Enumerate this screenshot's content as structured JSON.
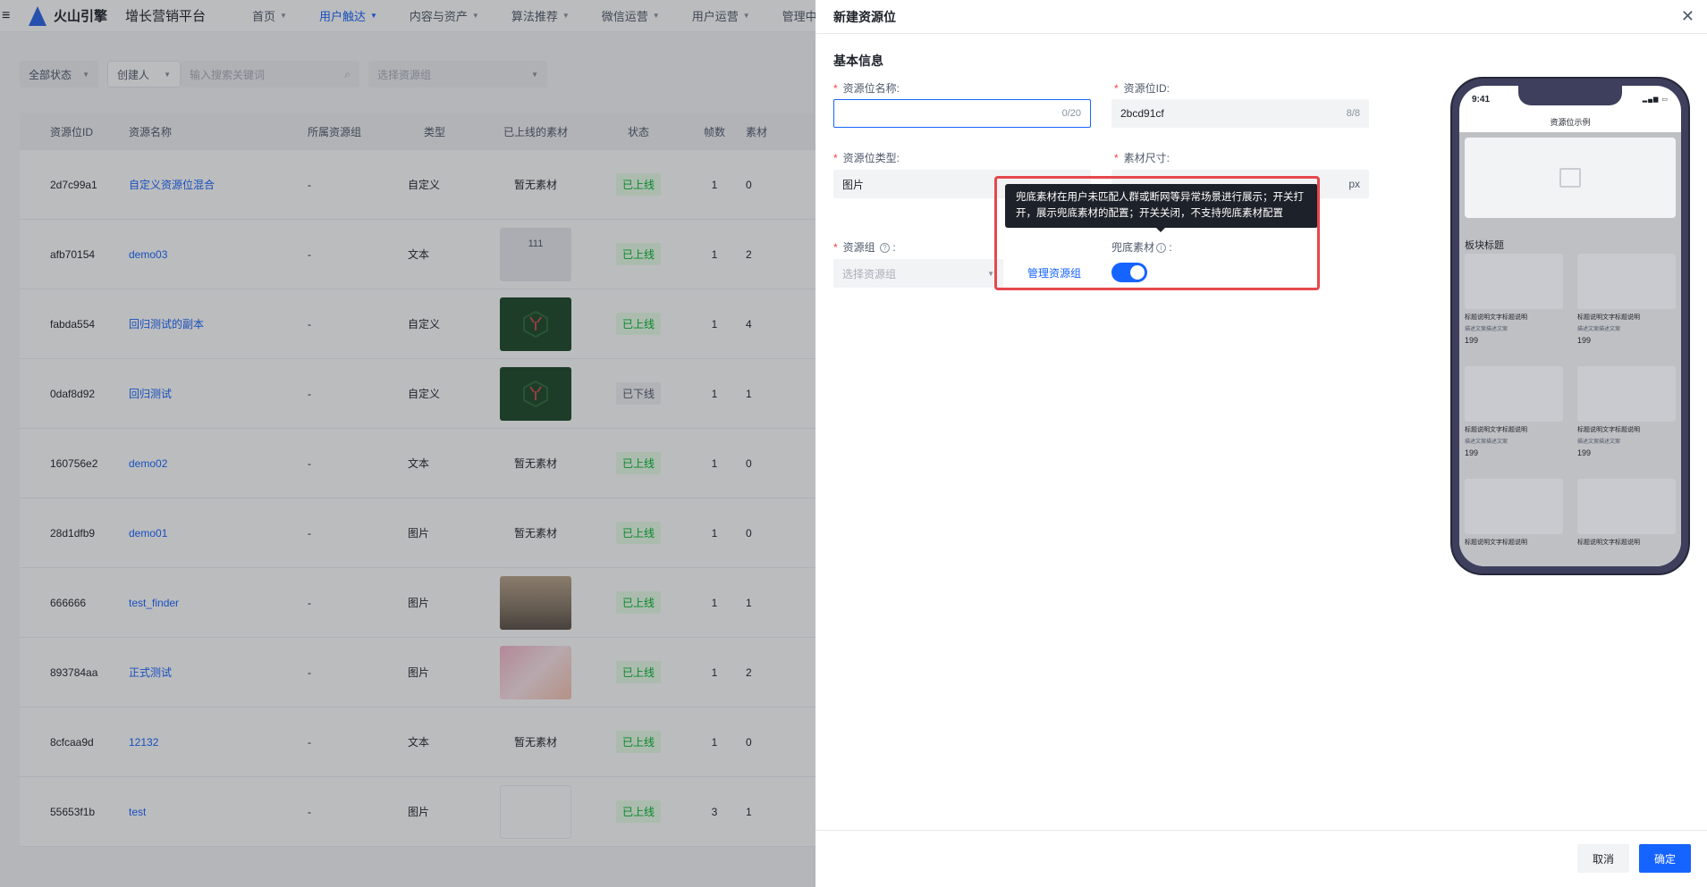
{
  "app": {
    "brand": "火山引擎",
    "platform": "增长营销平台",
    "nav": [
      {
        "label": "首页",
        "active": false
      },
      {
        "label": "用户触达",
        "active": true
      },
      {
        "label": "内容与资产",
        "active": false
      },
      {
        "label": "算法推荐",
        "active": false
      },
      {
        "label": "微信运营",
        "active": false
      },
      {
        "label": "用户运营",
        "active": false
      },
      {
        "label": "管理中心",
        "active": false
      }
    ]
  },
  "filters": {
    "status": "全部状态",
    "creator": "创建人",
    "search_placeholder": "输入搜索关键词",
    "group_placeholder": "选择资源组"
  },
  "table": {
    "columns": [
      "资源位ID",
      "资源名称",
      "所属资源组",
      "类型",
      "已上线的素材",
      "状态",
      "帧数",
      "素材"
    ],
    "rows": [
      {
        "id": "2d7c99a1",
        "name": "自定义资源位混合",
        "group": "-",
        "type": "自定义",
        "material": "暂无素材",
        "status": "已上线",
        "frames": "1",
        "count": "0"
      },
      {
        "id": "afb70154",
        "name": "demo03",
        "group": "-",
        "type": "文本",
        "material": "111",
        "status": "已上线",
        "frames": "1",
        "count": "2"
      },
      {
        "id": "fabda554",
        "name": "回归测试的副本",
        "group": "-",
        "type": "自定义",
        "material": "",
        "status": "已上线",
        "frames": "1",
        "count": "4"
      },
      {
        "id": "0daf8d92",
        "name": "回归测试",
        "group": "-",
        "type": "自定义",
        "material": "",
        "status": "已下线",
        "frames": "1",
        "count": "1"
      },
      {
        "id": "160756e2",
        "name": "demo02",
        "group": "-",
        "type": "文本",
        "material": "暂无素材",
        "status": "已上线",
        "frames": "1",
        "count": "0"
      },
      {
        "id": "28d1dfb9",
        "name": "demo01",
        "group": "-",
        "type": "图片",
        "material": "暂无素材",
        "status": "已上线",
        "frames": "1",
        "count": "0"
      },
      {
        "id": "666666",
        "name": "test_finder",
        "group": "-",
        "type": "图片",
        "material": "",
        "status": "已上线",
        "frames": "1",
        "count": "1"
      },
      {
        "id": "893784aa",
        "name": "正式测试",
        "group": "-",
        "type": "图片",
        "material": "",
        "status": "已上线",
        "frames": "1",
        "count": "2"
      },
      {
        "id": "8cfcaa9d",
        "name": "12132",
        "group": "-",
        "type": "文本",
        "material": "暂无素材",
        "status": "已上线",
        "frames": "1",
        "count": "0"
      },
      {
        "id": "55653f1b",
        "name": "test",
        "group": "-",
        "type": "图片",
        "material": "",
        "status": "已上线",
        "frames": "3",
        "count": "1"
      }
    ]
  },
  "drawer": {
    "title": "新建资源位",
    "section": "基本信息",
    "fields": {
      "name_label": "资源位名称:",
      "name_counter": "0/20",
      "id_label": "资源位ID:",
      "id_value": "2bcd91cf",
      "id_counter": "8/8",
      "type_label": "资源位类型:",
      "type_value": "图片",
      "size_label": "素材尺寸:",
      "size_unit": "px",
      "group_label": "资源组",
      "group_placeholder": "选择资源组",
      "manage_group": "管理资源组",
      "fallback_label": "兜底素材",
      "fallback_on": true
    },
    "tooltip": "兜底素材在用户未匹配人群或断网等异常场景进行展示；开关打开，展示兜底素材的配置；开关关闭，不支持兜底素材配置",
    "cancel": "取消",
    "confirm": "确定"
  },
  "preview": {
    "time": "9:41",
    "title": "资源位示例",
    "block_title": "板块标题",
    "cards": [
      {
        "title": "标题说明文字标题说明",
        "desc": "描述文案描述文案",
        "price": "199"
      },
      {
        "title": "标题说明文字标题说明",
        "desc": "描述文案描述文案",
        "price": "199"
      },
      {
        "title": "标题说明文字标题说明",
        "desc": "描述文案描述文案",
        "price": "199"
      },
      {
        "title": "标题说明文字标题说明",
        "desc": "描述文案描述文案",
        "price": "199"
      },
      {
        "title": "标题说明文字标题说明",
        "desc": "",
        "price": ""
      },
      {
        "title": "标题说明文字标题说明",
        "desc": "",
        "price": ""
      }
    ]
  }
}
